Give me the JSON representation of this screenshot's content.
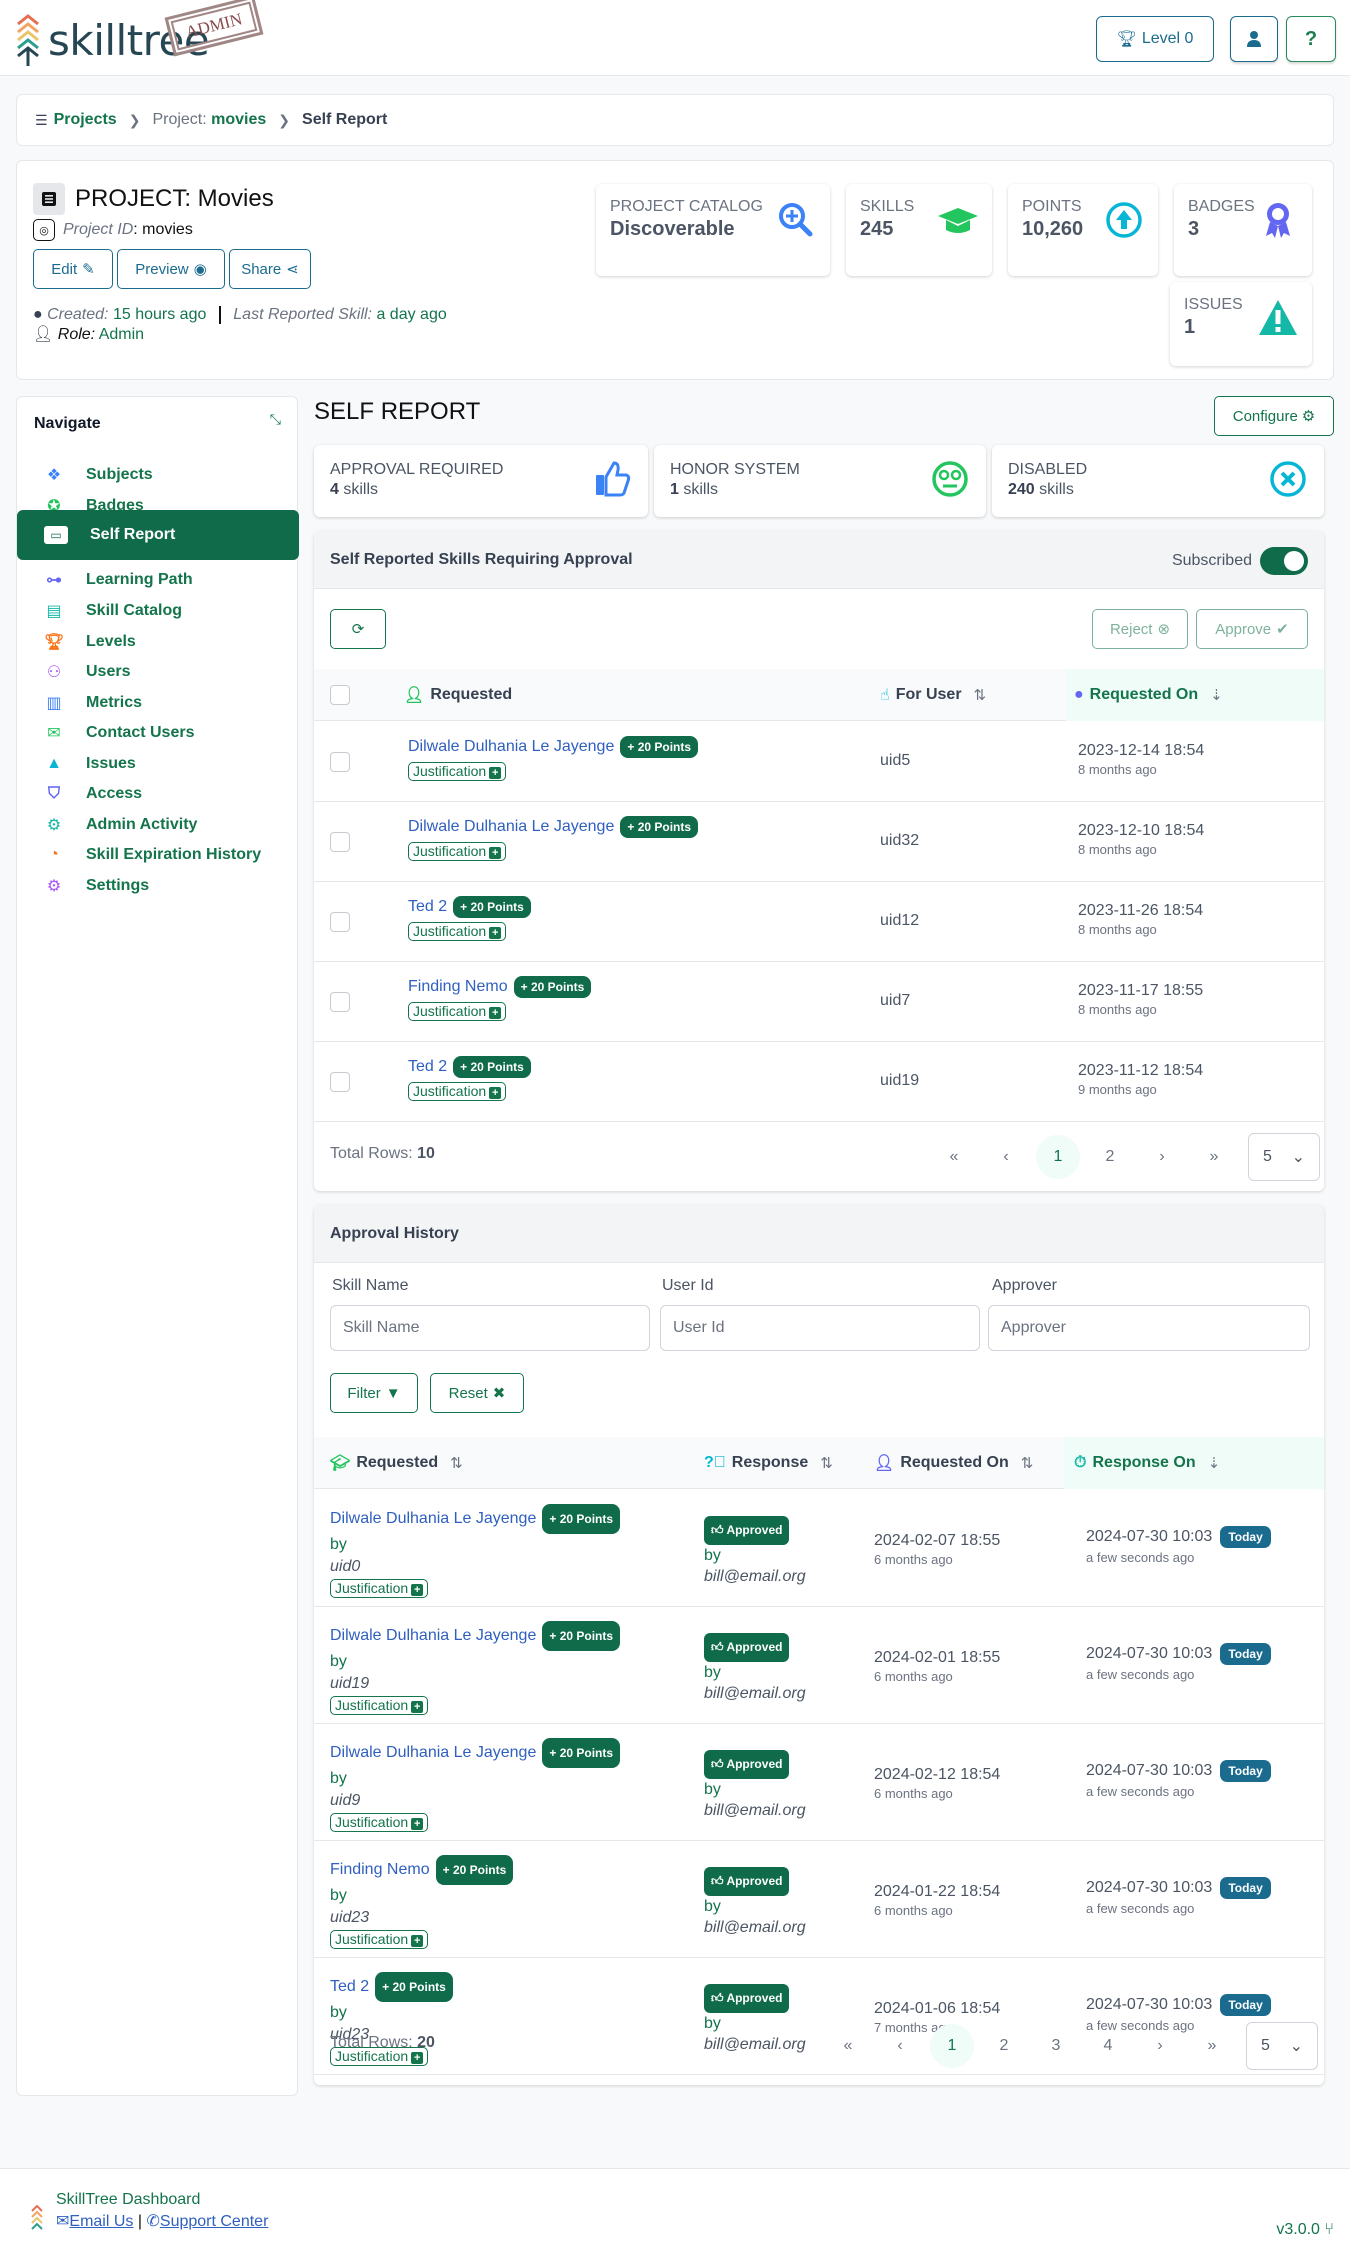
{
  "header": {
    "logo_text": "skilltree",
    "stamp": "ADMIN",
    "level_button": "Level 0"
  },
  "breadcrumb": {
    "projects": "Projects",
    "project_prefix": "Project:",
    "project": "movies",
    "current": "Self Report"
  },
  "project": {
    "title": "PROJECT: Movies",
    "id_label": "Project ID",
    "id_value": ": movies",
    "edit": "Edit",
    "preview": "Preview",
    "share": "Share",
    "created_label": "Created:",
    "created_value": "15 hours ago",
    "last_reported_label": "Last Reported Skill:",
    "last_reported_value": "a day ago",
    "role_label": "Role:",
    "role_value": "Admin"
  },
  "stats": {
    "catalog": {
      "label": "Project Catalog",
      "value": "Discoverable"
    },
    "skills": {
      "label": "Skills",
      "value": "245"
    },
    "points": {
      "label": "Points",
      "value": "10,260"
    },
    "badges": {
      "label": "Badges",
      "value": "3"
    },
    "issues": {
      "label": "Issues",
      "value": "1"
    }
  },
  "sidebar": {
    "title": "Navigate",
    "items": [
      {
        "label": "Subjects",
        "icon": "cubes-icon",
        "color": "#3b82f6"
      },
      {
        "label": "Badges",
        "icon": "award-icon",
        "color": "#22c55e"
      },
      {
        "label": "Self Report",
        "icon": "laptop-icon",
        "color": "#ffffff",
        "active": true
      },
      {
        "label": "Learning Path",
        "icon": "sitemap-icon",
        "color": "#6366f1"
      },
      {
        "label": "Skill Catalog",
        "icon": "book-icon",
        "color": "#14b8a6"
      },
      {
        "label": "Levels",
        "icon": "trophy-icon",
        "color": "#f97316"
      },
      {
        "label": "Users",
        "icon": "users-icon",
        "color": "#a855f7"
      },
      {
        "label": "Metrics",
        "icon": "chart-icon",
        "color": "#3b82f6"
      },
      {
        "label": "Contact Users",
        "icon": "mail-bulk-icon",
        "color": "#22c55e"
      },
      {
        "label": "Issues",
        "icon": "warning-icon",
        "color": "#06b6d4"
      },
      {
        "label": "Access",
        "icon": "shield-icon",
        "color": "#6366f1"
      },
      {
        "label": "Admin Activity",
        "icon": "users-cog-icon",
        "color": "#14b8a6"
      },
      {
        "label": "Skill Expiration History",
        "icon": "clock-icon",
        "color": "#f97316"
      },
      {
        "label": "Settings",
        "icon": "cogs-icon",
        "color": "#a855f7"
      }
    ]
  },
  "self_report": {
    "title": "SELF REPORT",
    "configure": "Configure",
    "modes": [
      {
        "label": "Approval Required",
        "count": "4",
        "unit": "skills"
      },
      {
        "label": "Honor System",
        "count": "1",
        "unit": "skills"
      },
      {
        "label": "Disabled",
        "count": "240",
        "unit": "skills"
      }
    ]
  },
  "approval": {
    "title": "Self Reported Skills Requiring Approval",
    "subscribed_label": "Subscribed",
    "subscribed": true,
    "reject": "Reject",
    "approve": "Approve",
    "columns": {
      "requested": "Requested",
      "for_user": "For User",
      "requested_on": "Requested On"
    },
    "rows": [
      {
        "skill": "Dilwale Dulhania Le Jayenge",
        "points": "+ 20 Points",
        "justification": "Justification",
        "user": "uid5",
        "date": "2023-12-14 18:54",
        "ago": "8 months ago"
      },
      {
        "skill": "Dilwale Dulhania Le Jayenge",
        "points": "+ 20 Points",
        "justification": "Justification",
        "user": "uid32",
        "date": "2023-12-10 18:54",
        "ago": "8 months ago"
      },
      {
        "skill": "Ted 2",
        "points": "+ 20 Points",
        "justification": "Justification",
        "user": "uid12",
        "date": "2023-11-26 18:54",
        "ago": "8 months ago"
      },
      {
        "skill": "Finding Nemo",
        "points": "+ 20 Points",
        "justification": "Justification",
        "user": "uid7",
        "date": "2023-11-17 18:55",
        "ago": "8 months ago"
      },
      {
        "skill": "Ted 2",
        "points": "+ 20 Points",
        "justification": "Justification",
        "user": "uid19",
        "date": "2023-11-12 18:54",
        "ago": "9 months ago"
      }
    ],
    "total_label": "Total Rows:",
    "total": "10",
    "pages": [
      "1",
      "2"
    ],
    "current_page": "1",
    "per_page": "5"
  },
  "history": {
    "title": "Approval History",
    "filters": {
      "skill_label": "Skill Name",
      "skill_placeholder": "Skill Name",
      "user_label": "User Id",
      "user_placeholder": "User Id",
      "approver_label": "Approver",
      "approver_placeholder": "Approver"
    },
    "filter_btn": "Filter",
    "reset_btn": "Reset",
    "columns": {
      "requested": "Requested",
      "response": "Response",
      "requested_on": "Requested On",
      "response_on": "Response On"
    },
    "rows": [
      {
        "skill": "Dilwale Dulhania Le Jayenge",
        "points": "+ 20 Points",
        "by": "by",
        "user": "uid0",
        "justification": "Justification",
        "status": "Approved",
        "approver": "bill@email.org",
        "req_date": "2024-02-07 18:55",
        "req_ago": "6 months ago",
        "resp_date": "2024-07-30 10:03",
        "resp_badge": "Today",
        "resp_ago": "a few seconds ago"
      },
      {
        "skill": "Dilwale Dulhania Le Jayenge",
        "points": "+ 20 Points",
        "by": "by",
        "user": "uid19",
        "justification": "Justification",
        "status": "Approved",
        "approver": "bill@email.org",
        "req_date": "2024-02-01 18:55",
        "req_ago": "6 months ago",
        "resp_date": "2024-07-30 10:03",
        "resp_badge": "Today",
        "resp_ago": "a few seconds ago"
      },
      {
        "skill": "Dilwale Dulhania Le Jayenge",
        "points": "+ 20 Points",
        "by": "by",
        "user": "uid9",
        "justification": "Justification",
        "status": "Approved",
        "approver": "bill@email.org",
        "req_date": "2024-02-12 18:54",
        "req_ago": "6 months ago",
        "resp_date": "2024-07-30 10:03",
        "resp_badge": "Today",
        "resp_ago": "a few seconds ago"
      },
      {
        "skill": "Finding Nemo",
        "points": "+ 20 Points",
        "by": "by",
        "user": "uid23",
        "justification": "Justification",
        "status": "Approved",
        "approver": "bill@email.org",
        "req_date": "2024-01-22 18:54",
        "req_ago": "6 months ago",
        "resp_date": "2024-07-30 10:03",
        "resp_badge": "Today",
        "resp_ago": "a few seconds ago"
      },
      {
        "skill": "Ted 2",
        "points": "+ 20 Points",
        "by": "by",
        "user": "uid23",
        "justification": "Justification",
        "status": "Approved",
        "approver": "bill@email.org",
        "req_date": "2024-01-06 18:54",
        "req_ago": "7 months ago",
        "resp_date": "2024-07-30 10:03",
        "resp_badge": "Today",
        "resp_ago": "a few seconds ago"
      }
    ],
    "total_label": "Total Rows:",
    "total": "20",
    "pages": [
      "1",
      "2",
      "3",
      "4"
    ],
    "current_page": "1",
    "per_page": "5"
  },
  "footer": {
    "title": "SkillTree Dashboard",
    "email": "Email Us",
    "support": "Support Center",
    "version": "v3.0.0"
  }
}
